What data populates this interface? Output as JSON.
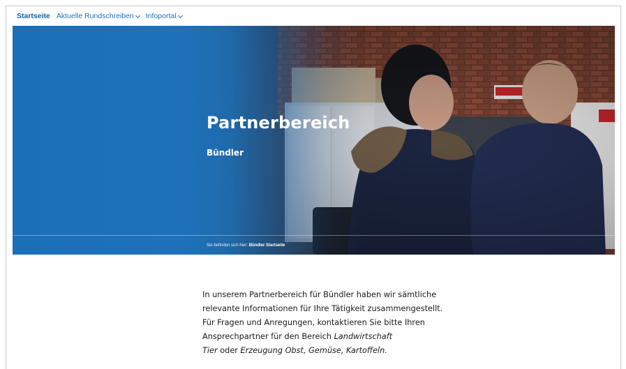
{
  "nav": {
    "items": [
      {
        "label": "Startseite",
        "active": true,
        "dropdown": false
      },
      {
        "label": "Aktuelle Rundschreiben",
        "active": false,
        "dropdown": true
      },
      {
        "label": "Infoportal",
        "active": false,
        "dropdown": true
      }
    ]
  },
  "hero": {
    "title": "Partnerbereich",
    "subtitle": "Bündler",
    "breadcrumb_prefix": "Sie befinden sich hier:",
    "breadcrumb_current": "Bündler Startseite",
    "overlay_color": "#1a6fb8"
  },
  "intro": {
    "line1": "In unserem Partnerbereich für Bündler haben wir sämtliche",
    "line2": "relevante Informationen für Ihre Tätigkeit zusammengestellt.",
    "line3": "Für Fragen und Anregungen, kontaktieren Sie bitte Ihren",
    "line4_plain": "Ansprechpartner für den Bereich ",
    "line4_italic": "Landwirtschaft",
    "line5_italic1": "Tier",
    "line5_plain": " oder ",
    "line5_italic2": "Erzeugung Obst, Gemüse, Kartoffeln."
  }
}
